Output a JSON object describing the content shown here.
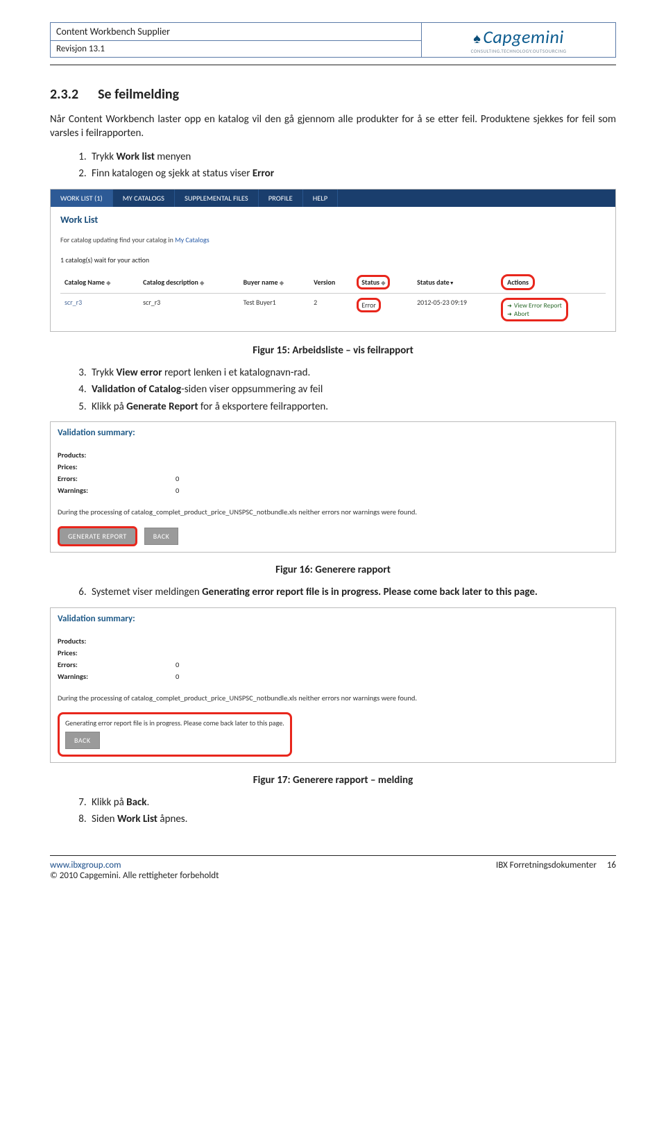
{
  "header": {
    "title": "Content Workbench Supplier",
    "revision": "Revisjon 13.1",
    "logo_main": "Capgemini",
    "logo_sub": "CONSULTING.TECHNOLOGY.OUTSOURCING"
  },
  "section": {
    "number": "2.3.2",
    "title": "Se feilmelding",
    "intro": "Når Content Workbench laster opp en katalog vil den gå gjennom alle produkter for å se etter feil. Produktene sjekkes for feil som varsles i feilrapporten.",
    "step1_a": "Trykk ",
    "step1_b": "Work list",
    "step1_c": " menyen",
    "step2_a": "Finn katalogen og sjekk at status viser ",
    "step2_b": "Error"
  },
  "shot1": {
    "nav": {
      "worklist": "WORK LIST (1)",
      "mycat": "MY CATALOGS",
      "supp": "SUPPLEMENTAL FILES",
      "profile": "PROFILE",
      "help": "HELP"
    },
    "title": "Work List",
    "sub_a": "For catalog updating find your catalog in ",
    "sub_b": "My Catalogs",
    "count": "1 catalog(s) wait for your action",
    "cols": {
      "name": "Catalog Name",
      "desc": "Catalog description",
      "buyer": "Buyer name",
      "version": "Version",
      "status": "Status",
      "date": "Status date",
      "actions": "Actions"
    },
    "row": {
      "name": "scr_r3",
      "desc": "scr_r3",
      "buyer": "Test Buyer1",
      "version": "2",
      "status": "Error",
      "date": "2012-05-23 09:19",
      "act1": "View Error Report",
      "act2": "Abort"
    }
  },
  "fig15": "Figur 15: Arbeidsliste – vis feilrapport",
  "steps2": {
    "s3_a": "Trykk ",
    "s3_b": "View error",
    "s3_c": " report lenken i et katalognavn-rad.",
    "s4_a": "Validation of Catalog",
    "s4_b": "-siden viser oppsummering av feil",
    "s5_a": "Klikk på ",
    "s5_b": "Generate Report",
    "s5_c": " for å eksportere feilrapporten."
  },
  "vshot": {
    "title": "Validation summary:",
    "products": "Products:",
    "prices": "Prices:",
    "errors": "Errors:",
    "errors_v": "0",
    "warnings": "Warnings:",
    "warnings_v": "0",
    "note": "During the processing of catalog_complet_product_price_UNSPSC_notbundle.xls neither errors nor warnings were found.",
    "btn_gen": "GENERATE REPORT",
    "btn_back": "BACK",
    "progress": "Generating error report file is in progress. Please come back later to this page."
  },
  "fig16": "Figur 16: Generere rapport",
  "step6_a": "Systemet viser meldingen ",
  "step6_b": "Generating error report file is in progress. Please come back later to this page.",
  "fig17": "Figur 17: Generere rapport – melding",
  "step7_a": "Klikk på ",
  "step7_b": "Back",
  "step7_c": ".",
  "step8_a": "Siden ",
  "step8_b": "Work List",
  "step8_c": " åpnes.",
  "footer": {
    "url": "www.ibxgroup.com",
    "copy": "© 2010 Capgemini. Alle rettigheter forbeholdt",
    "right": "IBX Forretningsdokumenter",
    "page": "16"
  }
}
